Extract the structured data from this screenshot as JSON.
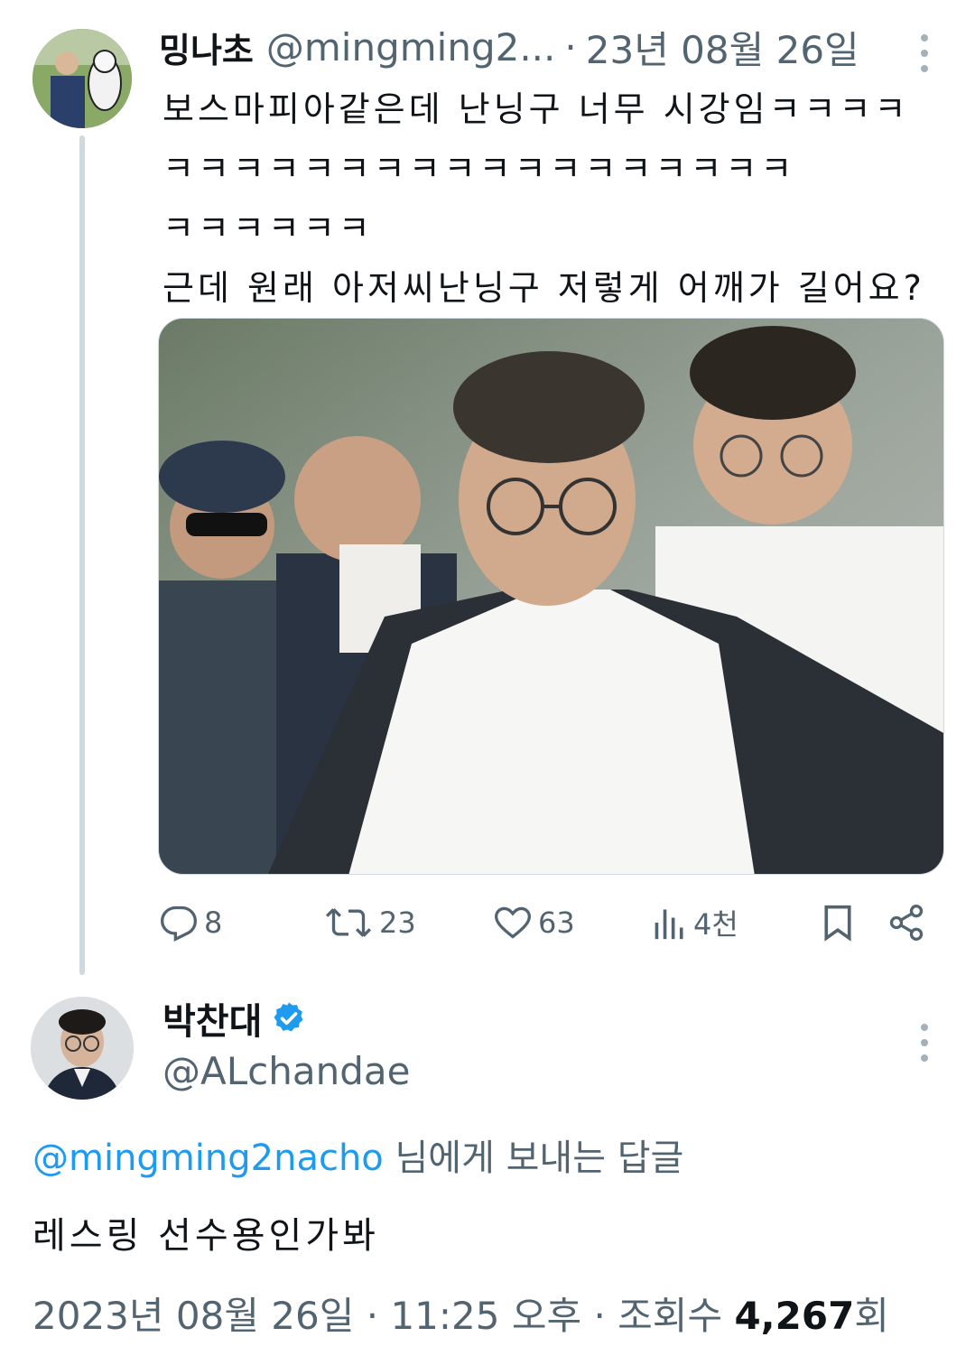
{
  "tweet1": {
    "author_name": "밍나초",
    "handle": "@mingming2...",
    "separator": "·",
    "date": "23년 08월 26일",
    "text": "보스마피아같은데 난닝구 너무 시강임ㅋㅋㅋㅋ\nㅋㅋㅋㅋㅋㅋㅋㅋㅋㅋㅋㅋㅋㅋㅋㅋㅋㅋ\nㅋㅋㅋㅋㅋㅋ\n근데 원래 아저씨난닝구 저렇게 어깨가 길어요?",
    "stats": {
      "replies": "8",
      "retweets": "23",
      "likes": "63",
      "views": "4천"
    }
  },
  "tweet2": {
    "author_name": "박찬대",
    "handle": "@ALchandae",
    "reply_mention": "@mingming2nacho",
    "reply_suffix": " 님에게 보내는 답글",
    "text": "레스링 선수용인가봐",
    "timestamp": "2023년 08월 26일 · 11:25 오후 · 조회수 ",
    "views_count": "4,267",
    "views_unit": "회"
  },
  "colors": {
    "text_primary": "#0f1419",
    "text_secondary": "#536471",
    "link_blue": "#1d9bf0",
    "verified_blue": "#1d9bf0",
    "thread_line": "#cfd9de"
  },
  "icons": [
    "more-icon",
    "reply-icon",
    "retweet-icon",
    "like-icon",
    "views-icon",
    "bookmark-icon",
    "share-icon",
    "verified-badge-icon"
  ]
}
